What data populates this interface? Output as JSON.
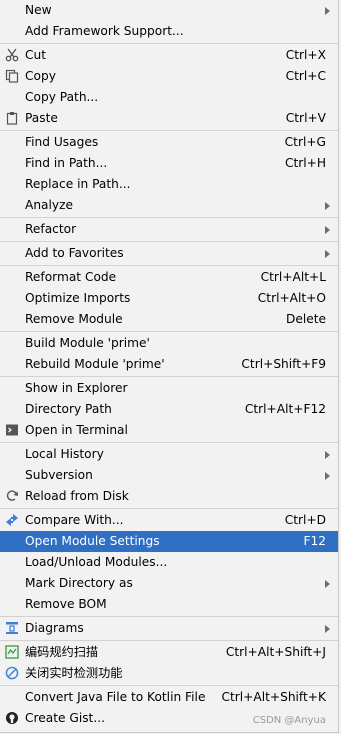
{
  "menu": {
    "new": "New",
    "add_framework": "Add Framework Support...",
    "cut": "Cut",
    "cut_sc": "Ctrl+X",
    "copy": "Copy",
    "copy_sc": "Ctrl+C",
    "copy_path": "Copy Path...",
    "paste": "Paste",
    "paste_sc": "Ctrl+V",
    "find_usages": "Find Usages",
    "find_usages_sc": "Ctrl+G",
    "find_in_path": "Find in Path...",
    "find_in_path_sc": "Ctrl+H",
    "replace_in_path": "Replace in Path...",
    "analyze": "Analyze",
    "refactor": "Refactor",
    "add_favorites": "Add to Favorites",
    "reformat": "Reformat Code",
    "reformat_sc": "Ctrl+Alt+L",
    "optimize": "Optimize Imports",
    "optimize_sc": "Ctrl+Alt+O",
    "remove_module": "Remove Module",
    "remove_module_sc": "Delete",
    "build_module": "Build Module 'prime'",
    "rebuild_module": "Rebuild Module 'prime'",
    "rebuild_module_sc": "Ctrl+Shift+F9",
    "show_explorer": "Show in Explorer",
    "directory_path": "Directory Path",
    "directory_path_sc": "Ctrl+Alt+F12",
    "open_terminal": "Open in Terminal",
    "local_history": "Local History",
    "subversion": "Subversion",
    "reload_disk": "Reload from Disk",
    "compare_with": "Compare With...",
    "compare_with_sc": "Ctrl+D",
    "open_module_settings": "Open Module Settings",
    "open_module_settings_sc": "F12",
    "load_unload": "Load/Unload Modules...",
    "mark_directory": "Mark Directory as",
    "remove_bom": "Remove BOM",
    "diagrams": "Diagrams",
    "code_scan": "编码规约扫描",
    "code_scan_sc": "Ctrl+Alt+Shift+J",
    "close_realtime": "关闭实时检测功能",
    "convert_kotlin": "Convert Java File to Kotlin File",
    "convert_kotlin_sc": "Ctrl+Alt+Shift+K",
    "create_gist": "Create Gist..."
  },
  "watermark": "CSDN @Anyua",
  "colors": {
    "selection": "#2f6fc4",
    "background": "#f2f2f2"
  }
}
